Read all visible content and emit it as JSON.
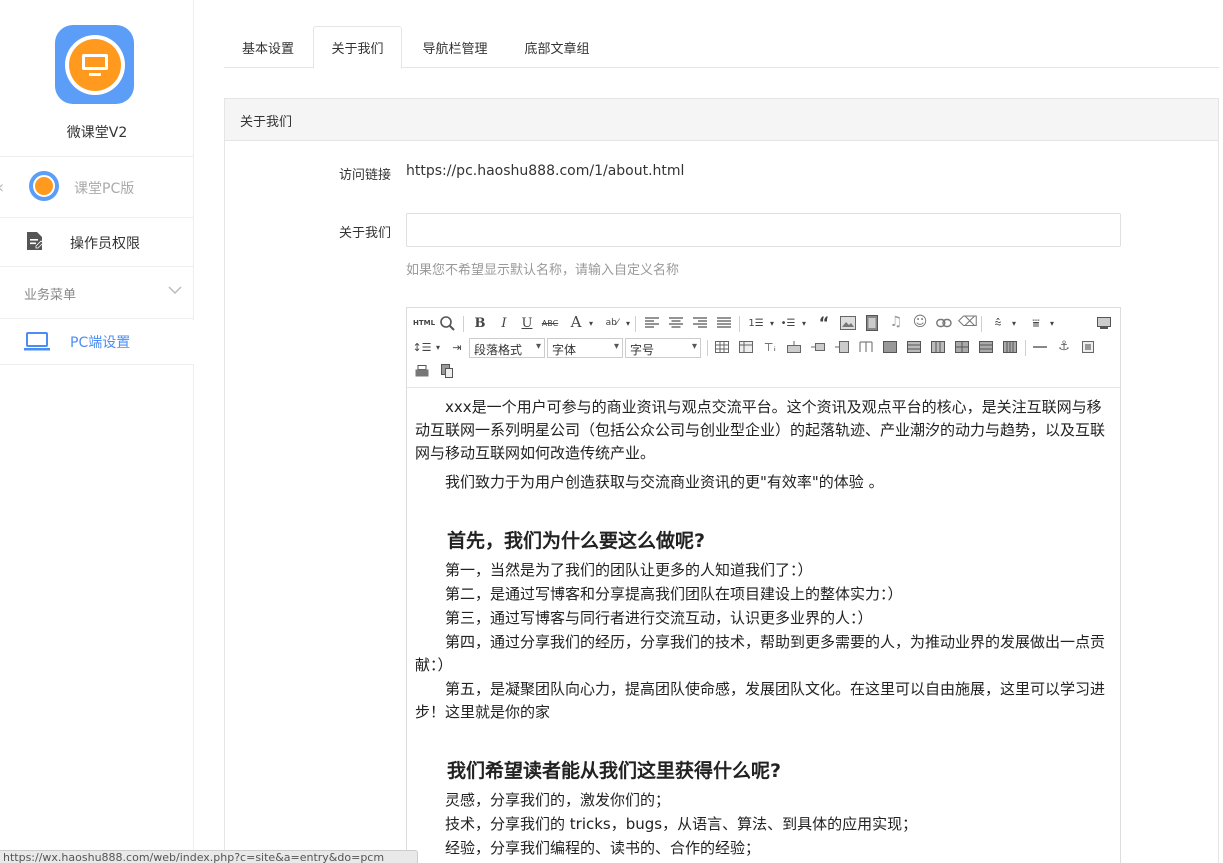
{
  "sidebar": {
    "app_name": "微课堂V2",
    "back_label": "课堂PC版",
    "permissions_label": "操作员权限",
    "business_menu_label": "业务菜单",
    "pc_settings_label": "PC端设置"
  },
  "tabs": [
    {
      "label": "基本设置"
    },
    {
      "label": "关于我们"
    },
    {
      "label": "导航栏管理"
    },
    {
      "label": "底部文章组"
    }
  ],
  "panel": {
    "title": "关于我们",
    "access_link_label": "访问链接",
    "access_link_value": "https://pc.haoshu888.com/1/about.html",
    "about_label": "关于我们",
    "about_value": "",
    "about_help": "如果您不希望显示默认名称，请输入自定义名称"
  },
  "editor": {
    "selects": {
      "paragraph": "段落格式",
      "font": "字体",
      "size": "字号"
    },
    "content": {
      "p1": "xxx是一个用户可参与的商业资讯与观点交流平台。这个资讯及观点平台的核心，是关注互联网与移动互联网一系列明星公司（包括公众公司与创业型企业）的起落轨迹、产业潮汐的动力与趋势，以及互联网与移动互联网如何改造传统产业。",
      "p2": "我们致力于为用户创造获取与交流商业资讯的更\"有效率\"的体验 。",
      "h1": "首先，我们为什么要这么做呢?",
      "l1": "第一，当然是为了我们的团队让更多的人知道我们了：）",
      "l2": "第二，是通过写博客和分享提高我们团队在项目建设上的整体实力：）",
      "l3": "第三，通过写博客与同行者进行交流互动，认识更多业界的人：）",
      "l4": "第四，通过分享我们的经历，分享我们的技术，帮助到更多需要的人，为推动业界的发展做出一点贡献：）",
      "l5": "第五，是凝聚团队向心力，提高团队使命感，发展团队文化。在这里可以自由施展，这里可以学习进步！这里就是你的家",
      "h2": "我们希望读者能从我们这里获得什么呢?",
      "m1": "灵感，分享我们的，激发你们的；",
      "m2": "技术，分享我们的 tricks，bugs，从语言、算法、到具体的应用实现；",
      "m3": "经验，分享我们编程的、读书的、合作的经验；"
    }
  },
  "status_url": "https://wx.haoshu888.com/web/index.php?c=site&a=entry&do=pcm",
  "colors": {
    "accent": "#4a8ef5",
    "logo_blue": "#5b9df7",
    "logo_orange": "#ff9a1f"
  }
}
